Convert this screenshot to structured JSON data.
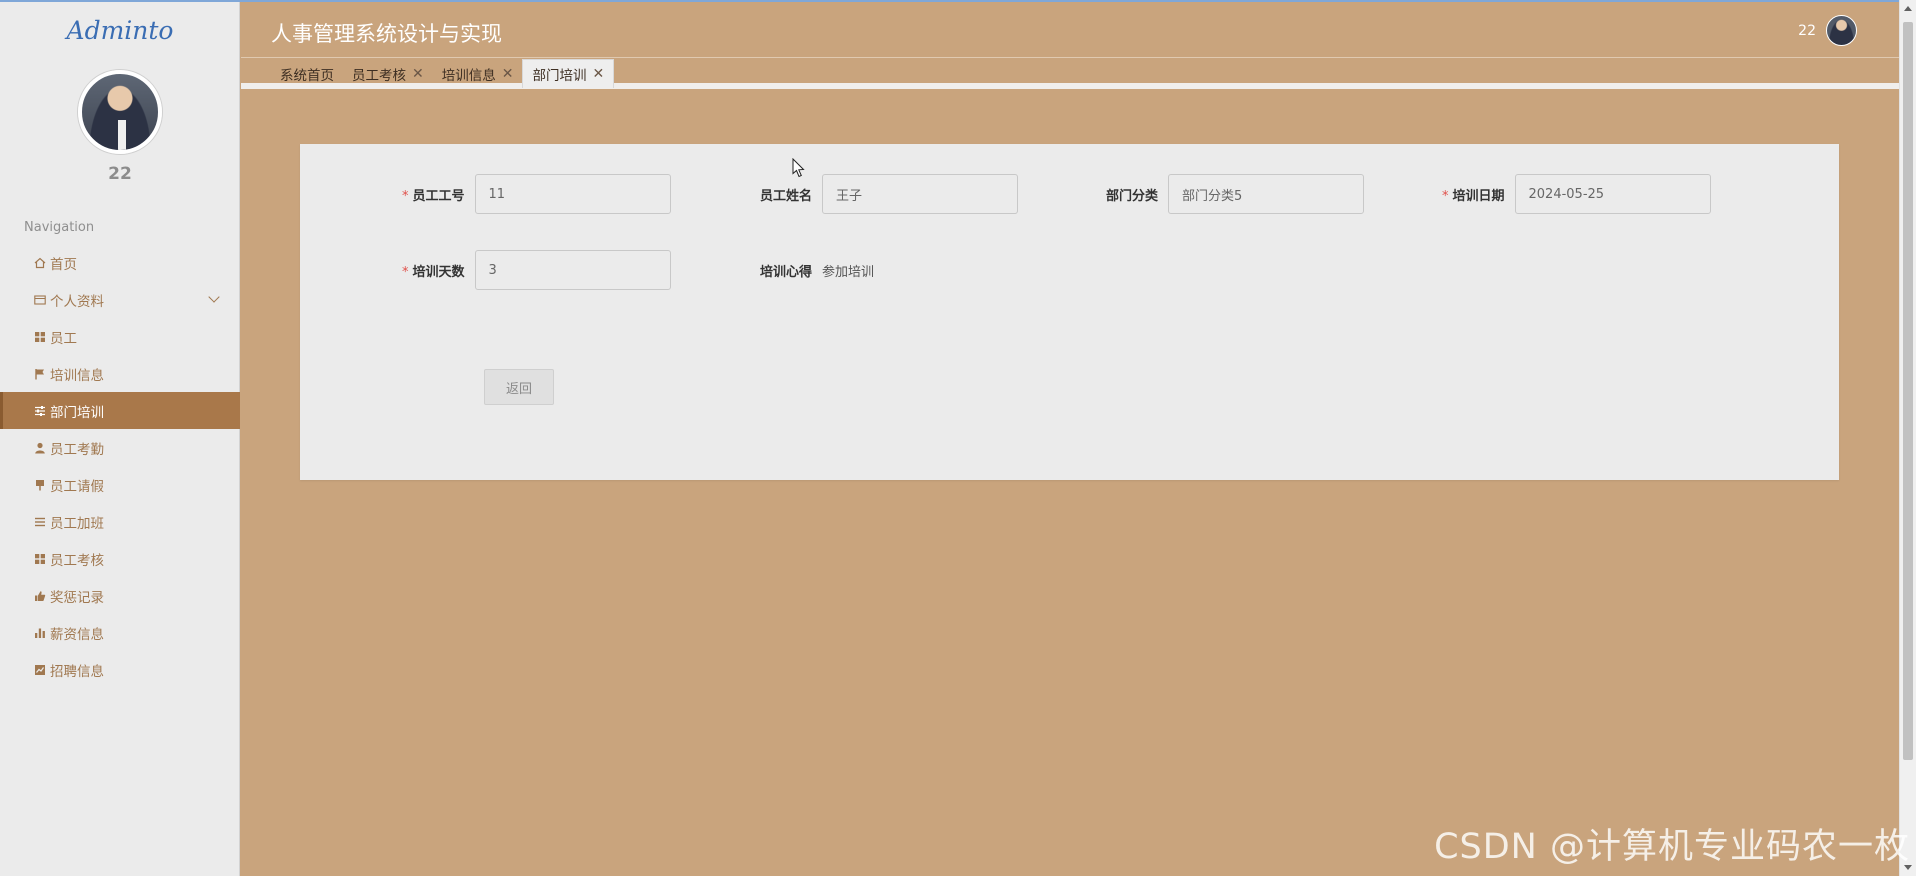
{
  "sidebar": {
    "logo": "Adminto",
    "user_name": "22",
    "nav_title": "Navigation",
    "items": [
      {
        "label": "首页",
        "icon": "home-icon"
      },
      {
        "label": "个人资料",
        "icon": "profile-card-icon"
      },
      {
        "label": "员工",
        "icon": "grid-icon"
      },
      {
        "label": "培训信息",
        "icon": "flag-icon"
      },
      {
        "label": "部门培训",
        "icon": "sliders-icon"
      },
      {
        "label": "员工考勤",
        "icon": "person-icon"
      },
      {
        "label": "员工请假",
        "icon": "pin-icon"
      },
      {
        "label": "员工加班",
        "icon": "list-icon"
      },
      {
        "label": "员工考核",
        "icon": "grid-icon"
      },
      {
        "label": "奖惩记录",
        "icon": "thumbs-up-icon"
      },
      {
        "label": "薪资信息",
        "icon": "bar-chart-icon"
      },
      {
        "label": "招聘信息",
        "icon": "line-chart-icon"
      }
    ],
    "active_item": "部门培训"
  },
  "header": {
    "title": "人事管理系统设计与实现",
    "user_name": "22"
  },
  "tabs": [
    {
      "label": "系统首页",
      "closable": false
    },
    {
      "label": "员工考核",
      "closable": true
    },
    {
      "label": "培训信息",
      "closable": true
    },
    {
      "label": "部门培训",
      "closable": true,
      "active": true
    }
  ],
  "form": {
    "employee_no": {
      "label": "员工工号",
      "value": "11",
      "required": true
    },
    "employee_name": {
      "label": "员工姓名",
      "value": "王子",
      "required": false
    },
    "department_category": {
      "label": "部门分类",
      "value": "部门分类5",
      "required": false
    },
    "training_date": {
      "label": "培训日期",
      "value": "2024-05-25",
      "required": true
    },
    "training_days": {
      "label": "培训天数",
      "value": "3",
      "required": true
    },
    "training_notes": {
      "label": "培训心得",
      "value": "参加培训",
      "required": false
    },
    "back_button": "返回",
    "required_mark": "*"
  },
  "watermark": "CSDN @计算机专业码农一枚",
  "colors": {
    "content_bg": "#c9a47d",
    "sidebar_bg": "#ebebeb",
    "active_nav_bg": "#a9784a",
    "nav_text": "#a07850",
    "required": "#e0504a",
    "logo": "#3a6db3"
  }
}
